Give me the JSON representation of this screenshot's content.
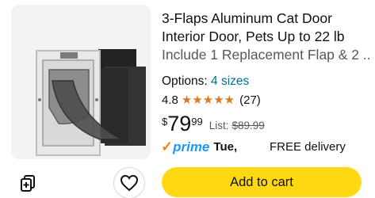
{
  "product": {
    "title_lines": [
      "3-Flaps Aluminum Cat Door",
      "Interior Door, Pets Up to 22 lb",
      "Include 1 Replacement Flap & 2 ..."
    ],
    "options_label": "Options:",
    "options_value": "4 sizes",
    "rating": "4.8",
    "stars_filled": 5,
    "review_count": "(27)",
    "price_symbol": "$",
    "price_whole": "79",
    "price_fraction": "99",
    "list_label": "List:",
    "list_price": "$89.99",
    "prime_check": "✓",
    "prime_label": "prime",
    "delivery_day": "Tue,",
    "delivery_text": "FREE delivery",
    "add_to_cart": "Add to cart"
  },
  "icons": {
    "compare": "compare-icon",
    "wishlist": "heart-icon",
    "star": "star-icon"
  },
  "colors": {
    "star": "#de7921",
    "link": "#007185",
    "prime_blue": "#1a98ff",
    "prime_check": "#f08804",
    "cart_button": "#ffd814",
    "muted": "#565959"
  }
}
